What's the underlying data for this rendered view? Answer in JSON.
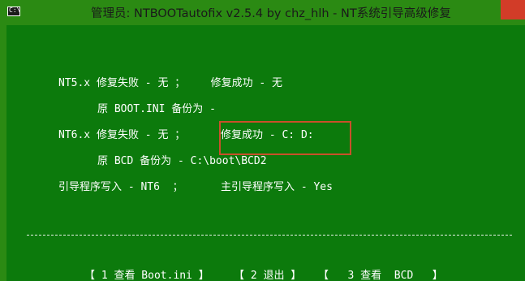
{
  "window": {
    "title": "管理员:  NTBOOTautofix v2.5.4 by chz_hlh - NT系统引导高级修复",
    "icon_text": "C:\\"
  },
  "console": {
    "nt5_line": "NT5.x 修复失败 - 无 ；    修复成功 - 无",
    "boot_ini_backup": "原 BOOT.INI 备份为 -",
    "nt6_fail": "NT6.x 修复失败 - 无 ；",
    "nt6_success": "修复成功 - C: D:",
    "bcd_backup": "原 BCD 备份为 - C:\\boot\\BCD2",
    "boot_writer": "引导程序写入 - NT6  ；",
    "master_boot_writer": "主引导程序写入 - Yes"
  },
  "menu": {
    "item1": "【 1 查看 Boot.ini 】",
    "item2": "【 2 退出 】",
    "item3": "【   3 查看  BCD   】"
  },
  "colors": {
    "console_bg": "#0c7a0c",
    "titlebar_bg": "#2b8a13",
    "highlight": "#c8502a",
    "close_button": "#d23c28"
  }
}
